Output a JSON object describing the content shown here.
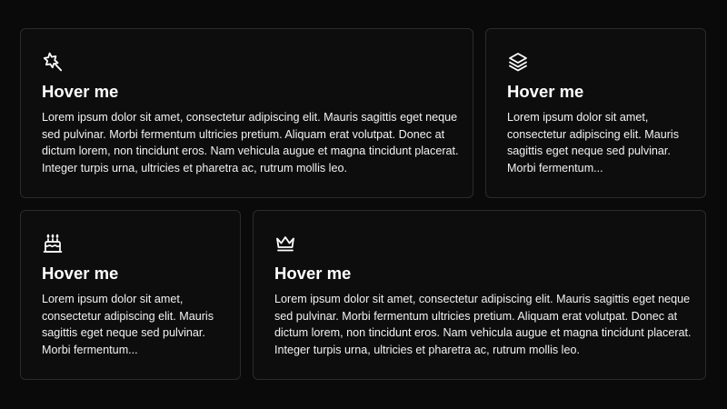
{
  "cards": [
    {
      "icon": "magic-wand-icon",
      "title": "Hover me",
      "text": "Lorem ipsum dolor sit amet, consectetur adipiscing elit. Mauris sagittis eget neque sed pulvinar. Morbi fermentum ultricies pretium. Aliquam erat volutpat. Donec at dictum lorem, non tincidunt eros. Nam vehicula augue et magna tincidunt placerat. Integer turpis urna, ultricies et pharetra ac, rutrum mollis leo."
    },
    {
      "icon": "stack-layers-icon",
      "title": "Hover me",
      "text": "Lorem ipsum dolor sit amet, consectetur adipiscing elit. Mauris sagittis eget neque sed pulvinar. Morbi fermentum..."
    },
    {
      "icon": "birthday-cake-icon",
      "title": "Hover me",
      "text": "Lorem ipsum dolor sit amet, consectetur adipiscing elit. Mauris sagittis eget neque sed pulvinar. Morbi fermentum..."
    },
    {
      "icon": "crown-icon",
      "title": "Hover me",
      "text": "Lorem ipsum dolor sit amet, consectetur adipiscing elit. Mauris sagittis eget neque sed pulvinar. Morbi fermentum ultricies pretium. Aliquam erat volutpat. Donec at dictum lorem, non tincidunt eros. Nam vehicula augue et magna tincidunt placerat. Integer turpis urna, ultricies et pharetra ac, rutrum mollis leo."
    }
  ],
  "colors": {
    "background": "#0a0a0a",
    "card_background": "#0d0d0d",
    "card_border": "#2b2b2b",
    "text": "#ffffff"
  }
}
